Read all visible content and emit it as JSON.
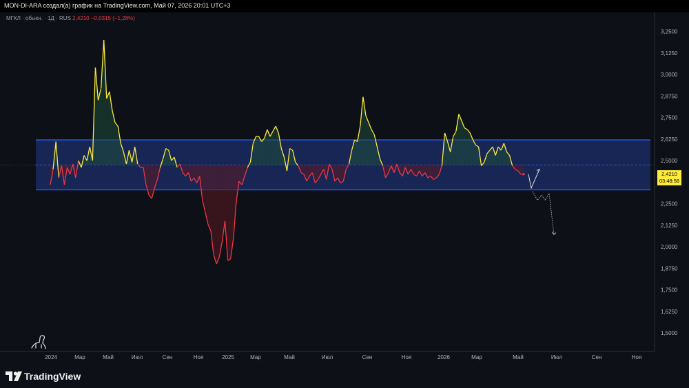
{
  "header": {
    "attribution": "MON-DI-ARA создал(а) график на TradingView.com, Май 07, 2026 20:01 UTC+3"
  },
  "legend": {
    "symbol": "МГКЛ · обыкн. · 1Д · RUS",
    "last": "2,4210",
    "change": "−0,0315 (−1,28%)"
  },
  "price_label": {
    "price": "2,4210",
    "countdown": "03:48:58"
  },
  "brand": {
    "name": "TradingView"
  },
  "colors": {
    "background": "#0d1117",
    "above_channel_mid": "#ffeb3b",
    "below_channel_mid": "#f23645",
    "channel_border": "#2962ff",
    "channel_fill": "#1c2d6b"
  },
  "chart_data": {
    "type": "line",
    "y_axis_ticks": [
      "3,2500",
      "3,1250",
      "3,0000",
      "2,8750",
      "2,7500",
      "2,6250",
      "2,5000",
      "2,3750",
      "2,2500",
      "2,1250",
      "2,0000",
      "1,8750",
      "1,7500",
      "1,6250",
      "1,5000"
    ],
    "ylim": [
      1.45,
      3.28
    ],
    "x_axis_ticks": [
      "2024",
      "Мар",
      "Май",
      "Июл",
      "Сен",
      "Ноя",
      "2025",
      "Мар",
      "Май",
      "Июл",
      "Сен",
      "Ноя",
      "2026",
      "Мар",
      "Май",
      "Июл",
      "Сен",
      "Ноя"
    ],
    "channel": {
      "upper": 2.62,
      "mid": 2.475,
      "lower": 2.33
    },
    "series": [
      {
        "values": [
          2.36,
          2.45,
          2.61,
          2.4,
          2.47,
          2.36,
          2.46,
          2.42,
          2.48,
          2.4,
          2.5,
          2.46,
          2.53,
          2.5,
          2.58,
          2.5,
          3.04,
          2.85,
          2.92,
          3.2,
          2.86,
          2.9,
          2.79,
          2.72,
          2.7,
          2.6,
          2.55,
          2.48,
          2.56,
          2.49,
          2.58,
          2.48,
          2.46,
          2.46,
          2.36,
          2.3,
          2.28,
          2.34,
          2.39,
          2.46,
          2.51,
          2.57,
          2.56,
          2.5,
          2.52,
          2.46,
          2.48,
          2.43,
          2.41,
          2.43,
          2.38,
          2.4,
          2.37,
          2.41,
          2.27,
          2.2,
          2.13,
          2.09,
          1.95,
          1.9,
          1.94,
          2.03,
          2.15,
          1.92,
          1.93,
          2.05,
          2.26,
          2.38,
          2.36,
          2.41,
          2.46,
          2.49,
          2.6,
          2.64,
          2.64,
          2.61,
          2.63,
          2.68,
          2.64,
          2.67,
          2.7,
          2.66,
          2.57,
          2.52,
          2.44,
          2.57,
          2.56,
          2.49,
          2.47,
          2.43,
          2.42,
          2.38,
          2.41,
          2.43,
          2.37,
          2.39,
          2.42,
          2.45,
          2.39,
          2.48,
          2.45,
          2.38,
          2.4,
          2.37,
          2.38,
          2.45,
          2.48,
          2.56,
          2.62,
          2.61,
          2.7,
          2.87,
          2.76,
          2.72,
          2.68,
          2.65,
          2.58,
          2.51,
          2.47,
          2.4,
          2.43,
          2.47,
          2.43,
          2.48,
          2.43,
          2.41,
          2.46,
          2.42,
          2.45,
          2.42,
          2.41,
          2.44,
          2.41,
          2.43,
          2.4,
          2.41,
          2.39,
          2.4,
          2.42,
          2.47,
          2.66,
          2.61,
          2.55,
          2.64,
          2.67,
          2.77,
          2.73,
          2.69,
          2.68,
          2.66,
          2.62,
          2.59,
          2.58,
          2.47,
          2.49,
          2.54,
          2.56,
          2.58,
          2.53,
          2.58,
          2.56,
          2.6,
          2.55,
          2.53,
          2.47,
          2.45,
          2.44,
          2.42,
          2.421
        ]
      }
    ],
    "forecast_primary": [
      2.421,
      2.34,
      2.45
    ],
    "forecast_alternative": [
      2.32,
      2.27,
      2.3,
      2.27,
      2.31,
      2.07
    ]
  }
}
